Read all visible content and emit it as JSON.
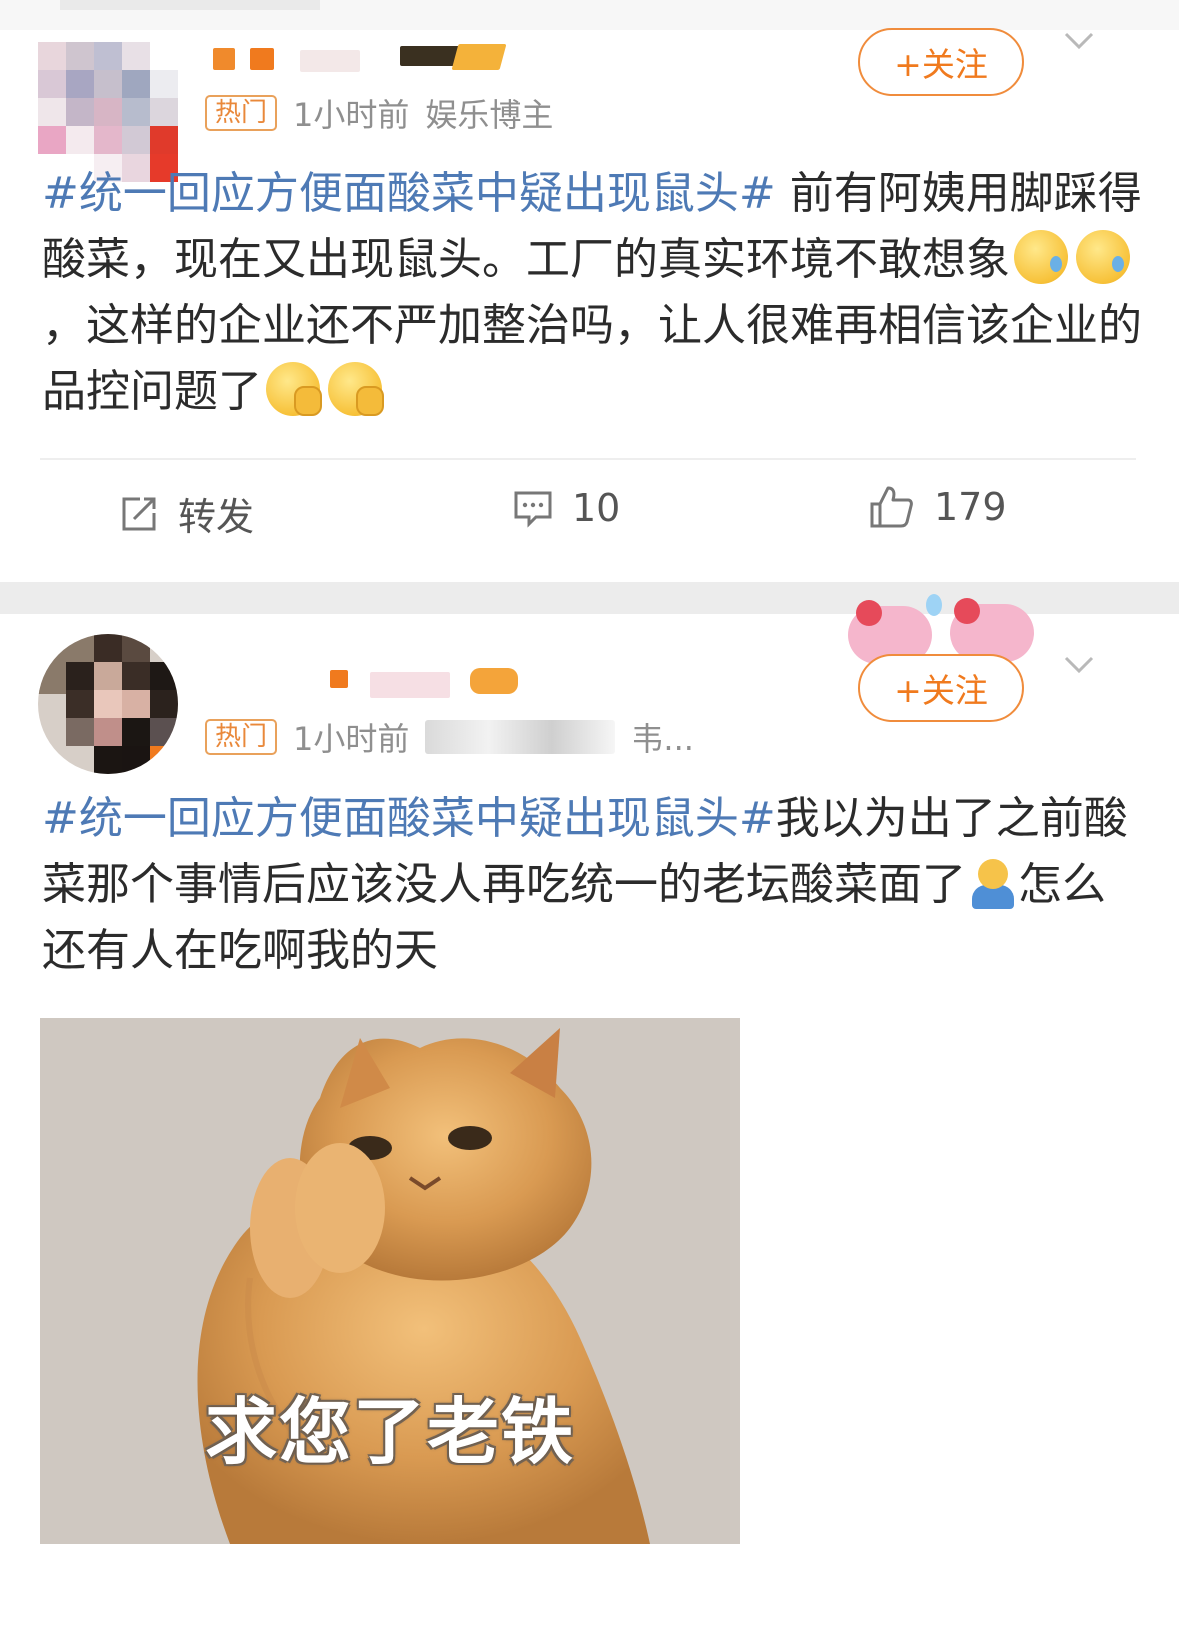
{
  "follow_label": "+关注",
  "post1": {
    "badge": "热门",
    "time": "1小时前",
    "category": "娱乐博主",
    "hashtag": "#统一回应方便面酸菜中疑出现鼠头#",
    "text_a": " 前有阿姨用脚踩得酸菜，现在又出现鼠头。工厂的真实环境不敢想象",
    "text_b": "，这样的企业还不严加整治吗，让人很难再相信该企业的品控问题了",
    "emoji_names": [
      "sweat-face-icon",
      "hand-over-mouth-icon"
    ],
    "actions": {
      "repost": "转发",
      "comments": "10",
      "likes": "179"
    }
  },
  "post2": {
    "badge": "热门",
    "time": "1小时前",
    "meta_trunc": "韦...",
    "hashtag": "#统一回应方便面酸菜中疑出现鼠头#",
    "text_a": "我以为出了之前酸菜那个事情后应该没人再吃统一的老坛酸菜面了",
    "text_b": "怎么还有人在吃啊我的天",
    "image_caption": "求您了老铁"
  },
  "colors": {
    "accent": "#f07a1e",
    "hashtag": "#4e7ab5",
    "badge": "#e9883a",
    "separator": "#ececec"
  }
}
